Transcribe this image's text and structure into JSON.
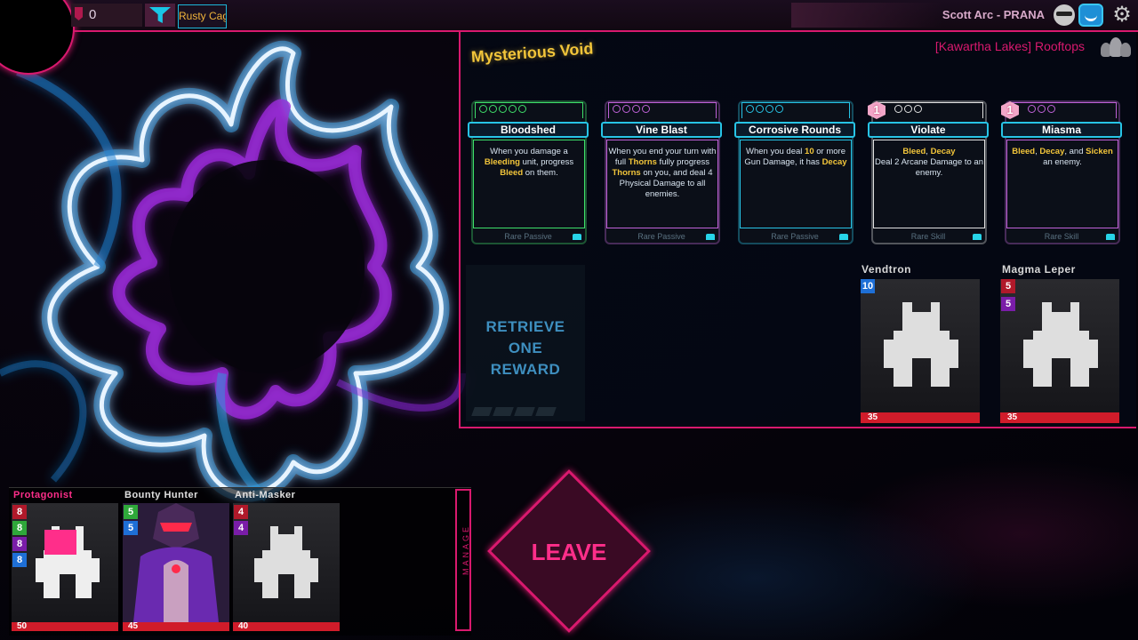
{
  "topbar": {
    "gem_count": "0",
    "relic": "Rusty Cage",
    "player": "Scott Arc - PRANA",
    "icons": [
      "sunglasses-face-icon",
      "blue-face-icon",
      "gear-icon"
    ]
  },
  "event": {
    "title": "Mysterious Void",
    "location": "[Kawartha Lakes] Rooftops"
  },
  "cards": [
    {
      "name": "Bloodshed",
      "rarity": "Rare Passive",
      "cost": "",
      "desc": "When you damage a <b>Bleeding</b> unit, progress <b>Bleed</b> on them.",
      "color": "#3ee06a",
      "pips": 5
    },
    {
      "name": "Vine Blast",
      "rarity": "Rare Passive",
      "cost": "",
      "desc": "When you end your turn with full <b>Thorns</b> fully progress <b>Thorns</b> on you, and deal 4 Physical Damage to all enemies.",
      "color": "#c062d8",
      "pips": 4
    },
    {
      "name": "Corrosive Rounds",
      "rarity": "Rare Passive",
      "cost": "",
      "desc": "When you deal <b>10</b> or more Gun Damage, it has <b>Decay</b>",
      "color": "#27c4e6",
      "pips": 4
    },
    {
      "name": "Violate",
      "rarity": "Rare Skill",
      "cost": "1",
      "desc": "<b>Bleed</b>, <b>Decay</b><br>Deal 2 Arcane Damage to an enemy.",
      "color": "#e0e0e0",
      "pips": 3
    },
    {
      "name": "Miasma",
      "rarity": "Rare Skill",
      "cost": "1",
      "desc": "<b>Bleed</b>, <b>Decay</b>, and <b>Sicken</b> an enemy.",
      "color": "#c062d8",
      "pips": 3
    }
  ],
  "retrieve": "RETRIEVE ONE REWARD",
  "enemies": [
    {
      "name": "Vendtron",
      "hp": "35",
      "stats": [
        {
          "v": "10",
          "c": "#1e6fd6"
        }
      ]
    },
    {
      "name": "Magma Leper",
      "hp": "35",
      "stats": [
        {
          "v": "5",
          "c": "#b0192a"
        },
        {
          "v": "5",
          "c": "#7a1da8"
        }
      ]
    }
  ],
  "party": [
    {
      "name": "Protagonist",
      "hp": "50",
      "name_color": "#ff2e8a",
      "stats": [
        {
          "v": "8",
          "c": "#b0192a"
        },
        {
          "v": "8",
          "c": "#2fa83a"
        },
        {
          "v": "8",
          "c": "#7a1da8"
        },
        {
          "v": "8",
          "c": "#1e6fd6"
        }
      ]
    },
    {
      "name": "Bounty Hunter",
      "hp": "45",
      "name_color": "#e0e0e0",
      "stats": [
        {
          "v": "5",
          "c": "#2fa83a"
        },
        {
          "v": "5",
          "c": "#1e6fd6"
        }
      ]
    },
    {
      "name": "Anti-Masker",
      "hp": "40",
      "name_color": "#e0e0e0",
      "stats": [
        {
          "v": "4",
          "c": "#b0192a"
        },
        {
          "v": "4",
          "c": "#7a1da8"
        }
      ]
    }
  ],
  "manage": "MANAGE",
  "leave": "LEAVE"
}
